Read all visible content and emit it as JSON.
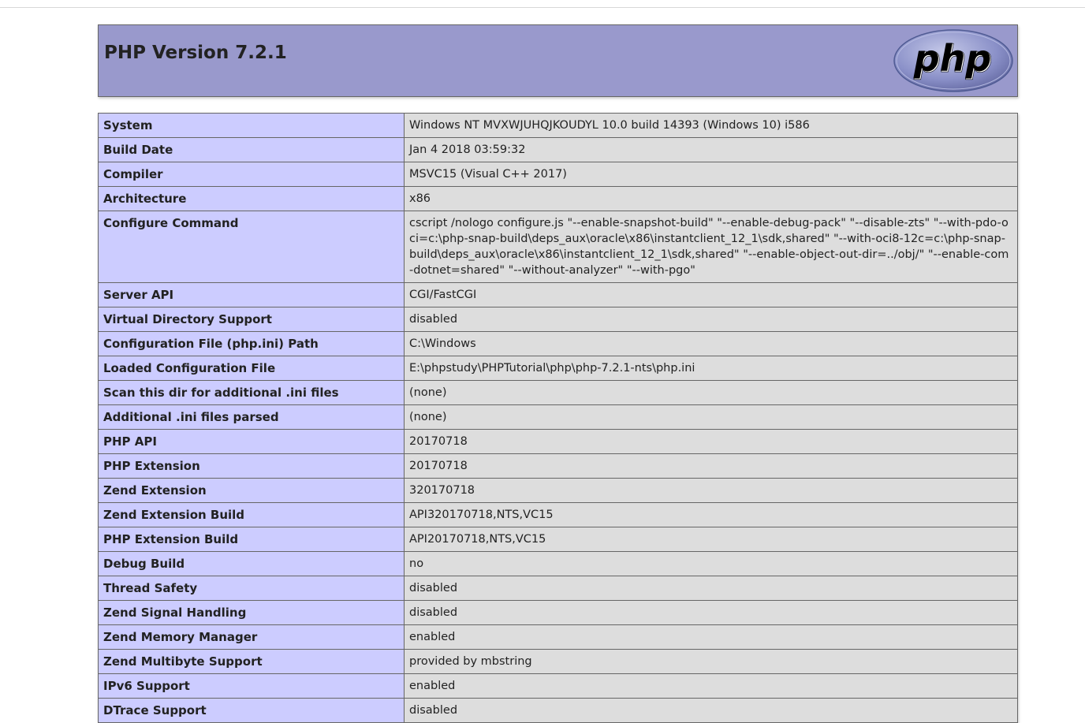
{
  "header": {
    "title": "PHP Version 7.2.1",
    "logo_text": "php",
    "colors": {
      "header_bg": "#9999cc",
      "key_bg": "#ccccff",
      "value_bg": "#dddddd",
      "border": "#666666"
    }
  },
  "rows": [
    {
      "key": "System",
      "value": "Windows NT MVXWJUHQJKOUDYL 10.0 build 14393 (Windows 10) i586"
    },
    {
      "key": "Build Date",
      "value": "Jan 4 2018 03:59:32"
    },
    {
      "key": "Compiler",
      "value": "MSVC15 (Visual C++ 2017)"
    },
    {
      "key": "Architecture",
      "value": "x86"
    },
    {
      "key": "Configure Command",
      "value": "cscript /nologo configure.js \"--enable-snapshot-build\" \"--enable-debug-pack\" \"--disable-zts\" \"--with-pdo-oci=c:\\php-snap-build\\deps_aux\\oracle\\x86\\instantclient_12_1\\sdk,shared\" \"--with-oci8-12c=c:\\php-snap-build\\deps_aux\\oracle\\x86\\instantclient_12_1\\sdk,shared\" \"--enable-object-out-dir=../obj/\" \"--enable-com-dotnet=shared\" \"--without-analyzer\" \"--with-pgo\""
    },
    {
      "key": "Server API",
      "value": "CGI/FastCGI"
    },
    {
      "key": "Virtual Directory Support",
      "value": "disabled"
    },
    {
      "key": "Configuration File (php.ini) Path",
      "value": "C:\\Windows"
    },
    {
      "key": "Loaded Configuration File",
      "value": "E:\\phpstudy\\PHPTutorial\\php\\php-7.2.1-nts\\php.ini"
    },
    {
      "key": "Scan this dir for additional .ini files",
      "value": "(none)"
    },
    {
      "key": "Additional .ini files parsed",
      "value": "(none)"
    },
    {
      "key": "PHP API",
      "value": "20170718"
    },
    {
      "key": "PHP Extension",
      "value": "20170718"
    },
    {
      "key": "Zend Extension",
      "value": "320170718"
    },
    {
      "key": "Zend Extension Build",
      "value": "API320170718,NTS,VC15"
    },
    {
      "key": "PHP Extension Build",
      "value": "API20170718,NTS,VC15"
    },
    {
      "key": "Debug Build",
      "value": "no"
    },
    {
      "key": "Thread Safety",
      "value": "disabled"
    },
    {
      "key": "Zend Signal Handling",
      "value": "disabled"
    },
    {
      "key": "Zend Memory Manager",
      "value": "enabled"
    },
    {
      "key": "Zend Multibyte Support",
      "value": "provided by mbstring"
    },
    {
      "key": "IPv6 Support",
      "value": "enabled"
    },
    {
      "key": "DTrace Support",
      "value": "disabled"
    }
  ]
}
